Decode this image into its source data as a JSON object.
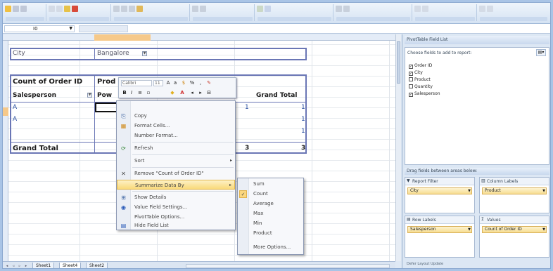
{
  "formula_bar": {
    "name_box": "I0"
  },
  "pivot": {
    "page_field": {
      "label": "City",
      "value": "Bangalore"
    },
    "data_label": "Count of Order ID",
    "col_field": "Prod",
    "row_header": "Salesperson",
    "row_header_cut": "Pow",
    "grand_total_col": "Grand Total",
    "rows": [
      {
        "label": "A",
        "v1": "1",
        "total": "1"
      },
      {
        "label": "A",
        "v1": "",
        "total": "1"
      },
      {
        "label": "",
        "v1": "",
        "total": "1"
      }
    ],
    "grand_total_row": {
      "label": "Grand Total",
      "v1": "3",
      "total": "3"
    }
  },
  "mini_toolbar": {
    "font": "Calibri",
    "size": "11"
  },
  "context_menu": {
    "items": [
      {
        "label": "Copy",
        "icon": "copy-icon",
        "glyph": "⎘"
      },
      {
        "label": "Format Cells...",
        "icon": "format-cells-icon",
        "glyph": "▦"
      },
      {
        "label": "Number Format...",
        "icon": "number-format-icon",
        "glyph": ""
      },
      {
        "label": "Refresh",
        "icon": "refresh-icon",
        "glyph": "⟳"
      },
      {
        "label": "Sort",
        "icon": "sort-icon",
        "glyph": ""
      },
      {
        "label": "Remove \"Count of Order ID\"",
        "icon": "remove-icon",
        "glyph": "✕"
      },
      {
        "label": "Summarize Data By",
        "icon": "",
        "glyph": ""
      },
      {
        "label": "Show Details",
        "icon": "show-details-icon",
        "glyph": "⊞"
      },
      {
        "label": "Value Field Settings...",
        "icon": "field-settings-icon",
        "glyph": "◉"
      },
      {
        "label": "PivotTable Options...",
        "icon": "",
        "glyph": ""
      },
      {
        "label": "Hide Field List",
        "icon": "field-list-icon",
        "glyph": "▤"
      }
    ]
  },
  "submenu": {
    "items": [
      "Sum",
      "Count",
      "Average",
      "Max",
      "Min",
      "Product",
      "More Options..."
    ],
    "checked_index": 1
  },
  "sheet_tabs": [
    "Sheet1",
    "Sheet4",
    "Sheet2"
  ],
  "field_list": {
    "title": "PivotTable Field List",
    "choose_label": "Choose fields to add to report:",
    "fields": [
      {
        "label": "Order ID",
        "checked": true
      },
      {
        "label": "City",
        "checked": true
      },
      {
        "label": "Product",
        "checked": false
      },
      {
        "label": "Quantity",
        "checked": false
      },
      {
        "label": "Salesperson",
        "checked": true
      }
    ],
    "drag_label": "Drag fields between areas below:",
    "areas": {
      "report_filter": {
        "label": "Report Filter",
        "chip": "City"
      },
      "column_labels": {
        "label": "Column Labels",
        "chip": "Product"
      },
      "row_labels": {
        "label": "Row Labels",
        "chip": "Salesperson"
      },
      "values": {
        "label": "Values",
        "chip": "Count of Order ID"
      }
    },
    "defer_label": "Defer Layout Update"
  }
}
